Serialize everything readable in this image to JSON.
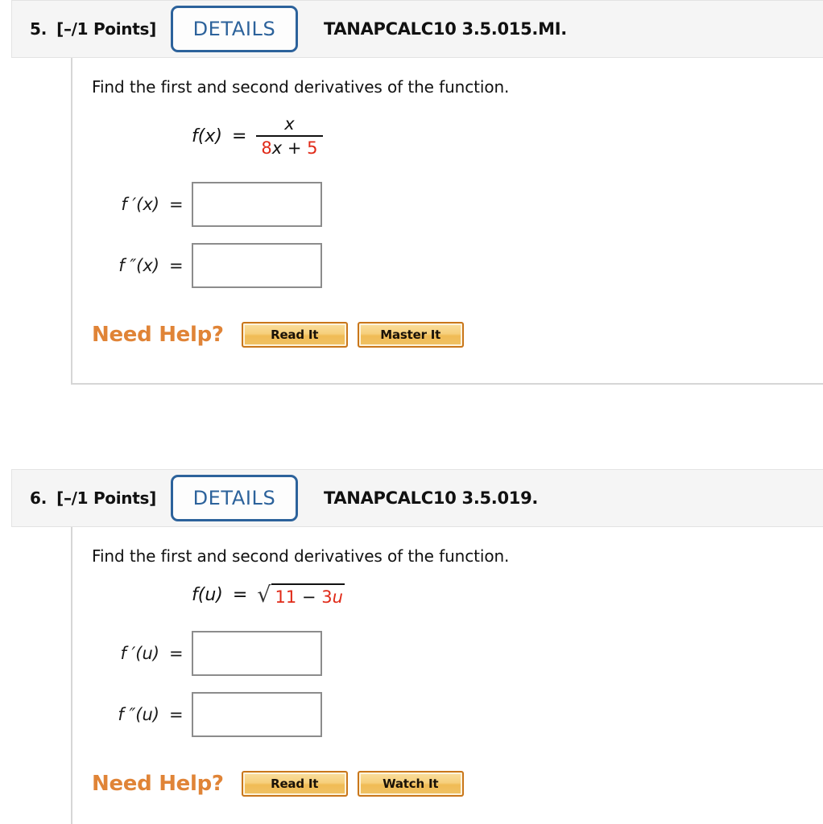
{
  "problems": [
    {
      "number": "5.",
      "points": "[–/1 Points]",
      "details_label": "DETAILS",
      "code": "TANAPCALC10 3.5.015.MI.",
      "prompt": "Find the first and second derivatives of the function.",
      "equation": {
        "type": "fraction",
        "lhs": "f(x)",
        "equals": "=",
        "numerator": "x",
        "denominator_parts": [
          {
            "text": "8",
            "color": "red"
          },
          {
            "text": "x",
            "color": "black",
            "italic": true
          },
          {
            "text": " + ",
            "color": "black"
          },
          {
            "text": "5",
            "color": "red"
          }
        ]
      },
      "answers": [
        {
          "label": "f ′(x)",
          "equals": "=",
          "value": "",
          "placeholder": ""
        },
        {
          "label": "f ″(x)",
          "equals": "=",
          "value": "",
          "placeholder": ""
        }
      ],
      "help": {
        "label": "Need Help?",
        "buttons": [
          "Read It",
          "Master It"
        ]
      }
    },
    {
      "number": "6.",
      "points": "[–/1 Points]",
      "details_label": "DETAILS",
      "code": "TANAPCALC10 3.5.019.",
      "prompt": "Find the first and second derivatives of the function.",
      "equation": {
        "type": "radical",
        "lhs": "f(u)",
        "equals": "=",
        "radical_symbol": "√",
        "radicand_parts": [
          {
            "text": "11",
            "color": "red"
          },
          {
            "text": " − ",
            "color": "black"
          },
          {
            "text": "3",
            "color": "red"
          },
          {
            "text": "u",
            "color": "red",
            "italic": true
          }
        ]
      },
      "answers": [
        {
          "label": "f ′(u)",
          "equals": "=",
          "value": "",
          "placeholder": ""
        },
        {
          "label": "f ″(u)",
          "equals": "=",
          "value": "",
          "placeholder": ""
        }
      ],
      "help": {
        "label": "Need Help?",
        "buttons": [
          "Read It",
          "Watch It"
        ]
      }
    }
  ],
  "colors": {
    "accent_blue": "#2c629b",
    "help_orange": "#e08437",
    "math_red": "#e02a18",
    "header_bg": "#f5f5f5",
    "rule_gray": "#d6d6d6",
    "input_border": "#8c8c8c"
  }
}
